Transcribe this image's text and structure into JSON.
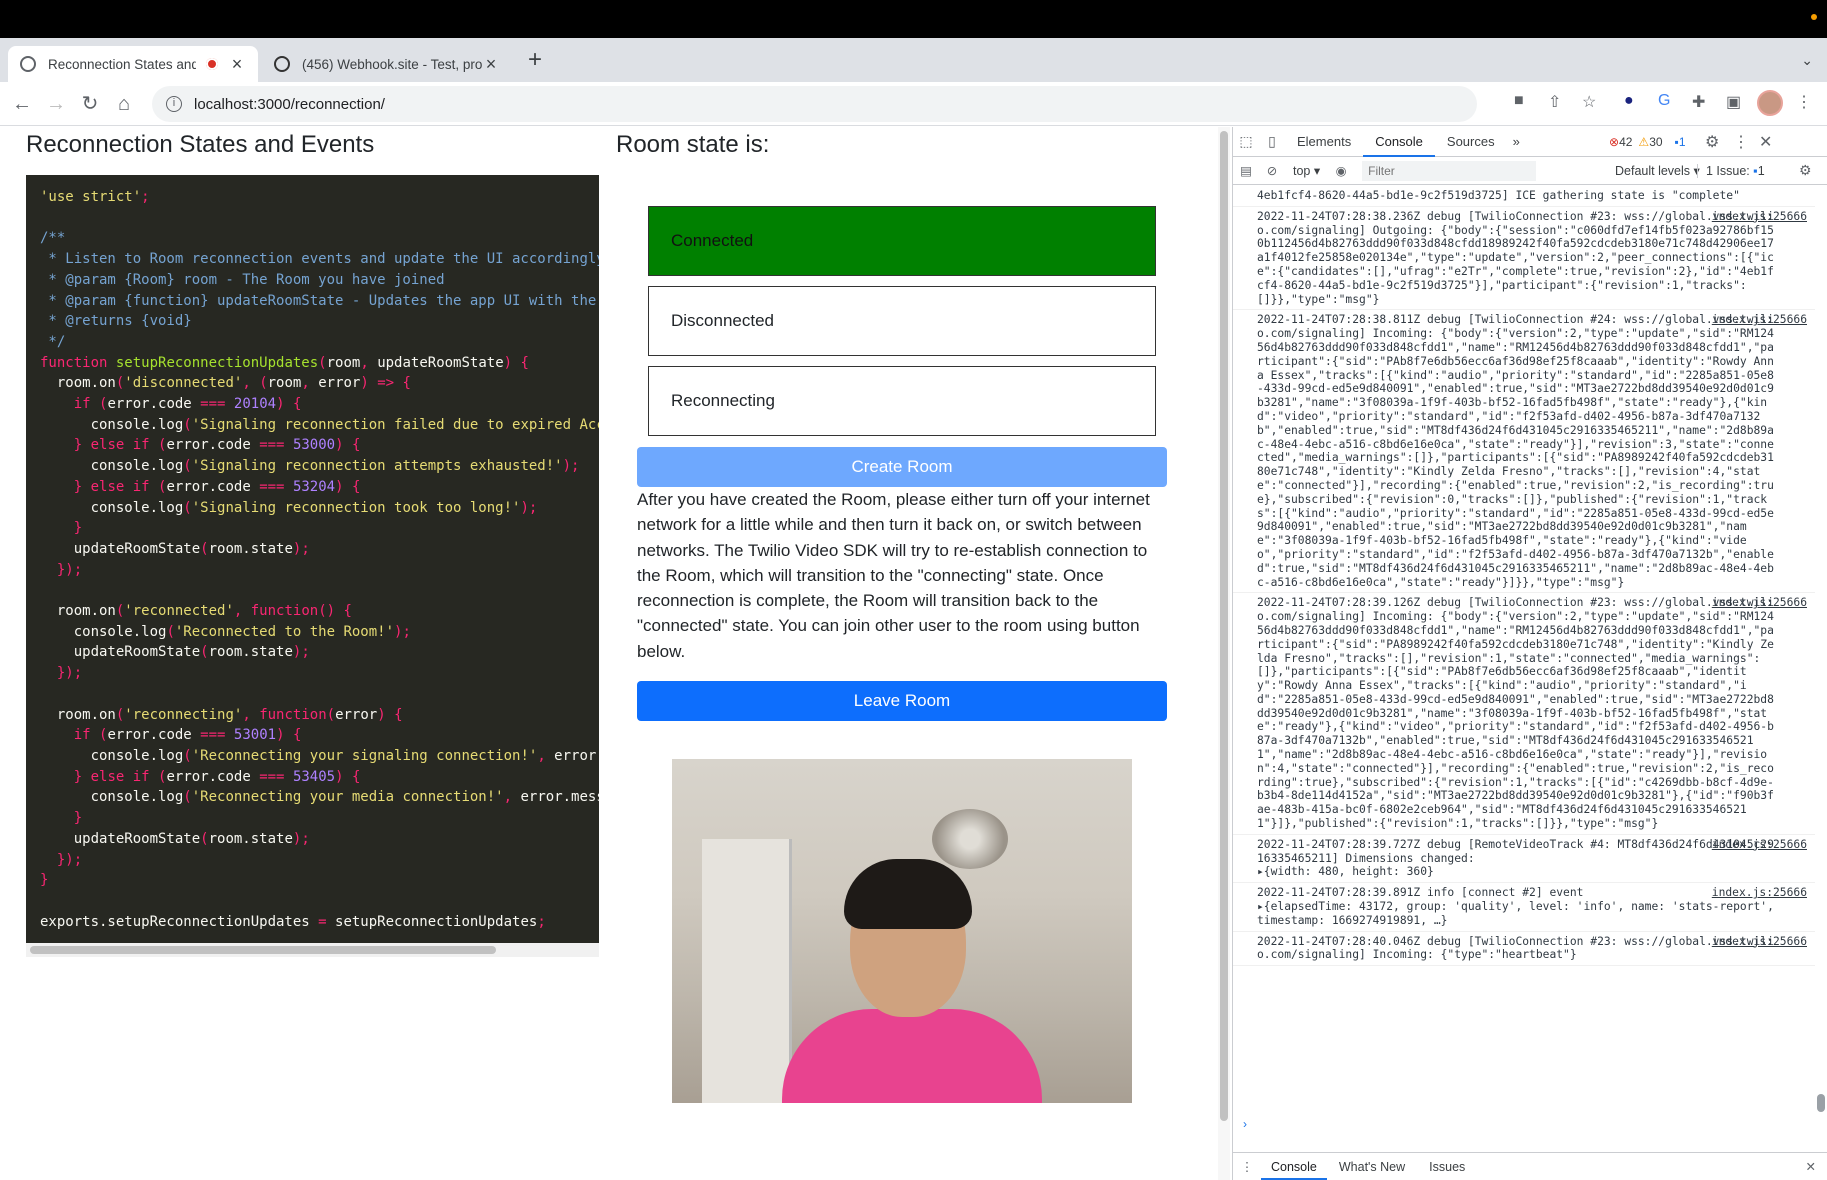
{
  "browser": {
    "tabs": [
      {
        "title": "Reconnection States and E",
        "active": true
      },
      {
        "title": "(456) Webhook.site - Test, pro",
        "active": false
      }
    ],
    "url": "localhost:3000/reconnection/"
  },
  "page": {
    "left_heading": "Reconnection States and Events",
    "right_heading": "Room state is:",
    "states": [
      {
        "label": "Connected",
        "active": true
      },
      {
        "label": "Disconnected",
        "active": false
      },
      {
        "label": "Reconnecting",
        "active": false
      }
    ],
    "create_button": "Create Room",
    "leave_button": "Leave Room",
    "description": "After you have created the Room, please either turn off your internet network for a little while and then turn it back on, or switch between networks. The Twilio Video SDK will try to re-establish connection to the Room, which will transition to the \"connecting\" state. Once reconnection is complete, the Room will transition back to the \"connected\" state. You can join other user to the room using button below.",
    "code_lines": [
      "'use strict';",
      "",
      "/**",
      " * Listen to Room reconnection events and update the UI accordingly.",
      " * @param {Room} room - The Room you have joined",
      " * @param {function} updateRoomState - Updates the app UI with the n",
      " * @returns {void}",
      " */",
      "function setupReconnectionUpdates(room, updateRoomState) {",
      "  room.on('disconnected', (room, error) => {",
      "    if (error.code === 20104) {",
      "      console.log('Signaling reconnection failed due to expired Acce",
      "    } else if (error.code === 53000) {",
      "      console.log('Signaling reconnection attempts exhausted!');",
      "    } else if (error.code === 53204) {",
      "      console.log('Signaling reconnection took too long!');",
      "    }",
      "    updateRoomState(room.state);",
      "  });",
      "",
      "  room.on('reconnected', function() {",
      "    console.log('Reconnected to the Room!');",
      "    updateRoomState(room.state);",
      "  });",
      "",
      "  room.on('reconnecting', function(error) {",
      "    if (error.code === 53001) {",
      "      console.log('Reconnecting your signaling connection!', error.m",
      "    } else if (error.code === 53405) {",
      "      console.log('Reconnecting your media connection!', error.messa",
      "    }",
      "    updateRoomState(room.state);",
      "  });",
      "}",
      "",
      "exports.setupReconnectionUpdates = setupReconnectionUpdates;"
    ]
  },
  "devtools": {
    "tabs": [
      "Elements",
      "Console",
      "Sources"
    ],
    "more": "»",
    "errors": "42",
    "warnings": "30",
    "messages": "1",
    "context": "top",
    "filter_placeholder": "Filter",
    "levels": "Default levels",
    "issues": "1 Issue:",
    "issues_count": "1",
    "drawer_tabs": [
      "Console",
      "What's New",
      "Issues"
    ],
    "messages_list": [
      {
        "text": "4eb1fcf4-8620-44a5-bd1e-9c2f519d3725] ICE gathering state is \"complete\"",
        "src": ""
      },
      {
        "text": "2022-11-24T07:28:38.236Z debug [TwilioConnection #23: wss://global.vss.twilio.com/signaling] Outgoing: {\"body\":{\"session\":\"c060dfd7ef14fb5f023a92786bf150b112456d4b82763ddd90f033d848cfdd18989242f40fa592cdcdeb3180e71c748d42906ee17a1f4012fe25858e020134e\",\"type\":\"update\",\"version\":2,\"peer_connections\":[{\"ice\":{\"candidates\":[],\"ufrag\":\"e2Tr\",\"complete\":true,\"revision\":2},\"id\":\"4eb1fcf4-8620-44a5-bd1e-9c2f519d3725\"}],\"participant\":{\"revision\":1,\"tracks\":[]}},\"type\":\"msg\"}",
        "src": "index.js:25666"
      },
      {
        "text": "2022-11-24T07:28:38.811Z debug [TwilioConnection #24: wss://global.vss.twilio.com/signaling] Incoming: {\"body\":{\"version\":2,\"type\":\"update\",\"sid\":\"RM12456d4b82763ddd90f033d848cfdd1\",\"name\":\"RM12456d4b82763ddd90f033d848cfdd1\",\"participant\":{\"sid\":\"PAb8f7e6db56ecc6af36d98ef25f8caaab\",\"identity\":\"Rowdy Anna Essex\",\"tracks\":[{\"kind\":\"audio\",\"priority\":\"standard\",\"id\":\"2285a851-05e8-433d-99cd-ed5e9d840091\",\"enabled\":true,\"sid\":\"MT3ae2722bd8dd39540e92d0d01c9b3281\",\"name\":\"3f08039a-1f9f-403b-bf52-16fad5fb498f\",\"state\":\"ready\"},{\"kind\":\"video\",\"priority\":\"standard\",\"id\":\"f2f53afd-d402-4956-b87a-3df470a7132b\",\"enabled\":true,\"sid\":\"MT8df436d24f6d431045c2916335465211\",\"name\":\"2d8b89ac-48e4-4ebc-a516-c8bd6e16e0ca\",\"state\":\"ready\"}],\"revision\":3,\"state\":\"connected\",\"media_warnings\":[]},\"participants\":[{\"sid\":\"PA8989242f40fa592cdcdeb3180e71c748\",\"identity\":\"Kindly Zelda Fresno\",\"tracks\":[],\"revision\":4,\"state\":\"connected\"}],\"recording\":{\"enabled\":true,\"revision\":2,\"is_recording\":true},\"subscribed\":{\"revision\":0,\"tracks\":[]},\"published\":{\"revision\":1,\"tracks\":[{\"kind\":\"audio\",\"priority\":\"standard\",\"id\":\"2285a851-05e8-433d-99cd-ed5e9d840091\",\"enabled\":true,\"sid\":\"MT3ae2722bd8dd39540e92d0d01c9b3281\",\"name\":\"3f08039a-1f9f-403b-bf52-16fad5fb498f\",\"state\":\"ready\"},{\"kind\":\"video\",\"priority\":\"standard\",\"id\":\"f2f53afd-d402-4956-b87a-3df470a7132b\",\"enabled\":true,\"sid\":\"MT8df436d24f6d431045c2916335465211\",\"name\":\"2d8b89ac-48e4-4ebc-a516-c8bd6e16e0ca\",\"state\":\"ready\"}]}},\"type\":\"msg\"}",
        "src": "index.js:25666"
      },
      {
        "text": "2022-11-24T07:28:39.126Z debug [TwilioConnection #23: wss://global.vss.twilio.com/signaling] Incoming: {\"body\":{\"version\":2,\"type\":\"update\",\"sid\":\"RM12456d4b82763ddd90f033d848cfdd1\",\"name\":\"RM12456d4b82763ddd90f033d848cfdd1\",\"participant\":{\"sid\":\"PA8989242f40fa592cdcdeb3180e71c748\",\"identity\":\"Kindly Zelda Fresno\",\"tracks\":[],\"revision\":1,\"state\":\"connected\",\"media_warnings\":[]},\"participants\":[{\"sid\":\"PAb8f7e6db56ecc6af36d98ef25f8caaab\",\"identity\":\"Rowdy Anna Essex\",\"tracks\":[{\"kind\":\"audio\",\"priority\":\"standard\",\"id\":\"2285a851-05e8-433d-99cd-ed5e9d840091\",\"enabled\":true,\"sid\":\"MT3ae2722bd8dd39540e92d0d01c9b3281\",\"name\":\"3f08039a-1f9f-403b-bf52-16fad5fb498f\",\"state\":\"ready\"},{\"kind\":\"video\",\"priority\":\"standard\",\"id\":\"f2f53afd-d402-4956-b87a-3df470a7132b\",\"enabled\":true,\"sid\":\"MT8df436d24f6d431045c2916335465211\",\"name\":\"2d8b89ac-48e4-4ebc-a516-c8bd6e16e0ca\",\"state\":\"ready\"}],\"revision\":4,\"state\":\"connected\"}],\"recording\":{\"enabled\":true,\"revision\":2,\"is_recording\":true},\"subscribed\":{\"revision\":1,\"tracks\":[{\"id\":\"c4269dbb-b8cf-4d9e-b3b4-8de114d4152a\",\"sid\":\"MT3ae2722bd8dd39540e92d0d01c9b3281\"},{\"id\":\"f90b3fae-483b-415a-bc0f-6802e2ceb964\",\"sid\":\"MT8df436d24f6d431045c2916335465211\"}]},\"published\":{\"revision\":1,\"tracks\":[]}},\"type\":\"msg\"}",
        "src": "index.js:25666"
      },
      {
        "text": "2022-11-24T07:28:39.727Z debug [RemoteVideoTrack #4: MT8df436d24f6d431045c2916335465211] Dimensions changed:",
        "src": "index.js:25666",
        "obj": "{width: 480, height: 360}"
      },
      {
        "text": "2022-11-24T07:28:39.891Z info [connect #2] event",
        "src": "index.js:25666",
        "obj": "{elapsedTime: 43172, group: 'quality', level: 'info', name: 'stats-report', timestamp: 1669274919891, …}"
      },
      {
        "text": "2022-11-24T07:28:40.046Z debug [TwilioConnection #23: wss://global.vss.twilio.com/signaling] Incoming: {\"type\":\"heartbeat\"}",
        "src": "index.js:25666"
      }
    ]
  }
}
